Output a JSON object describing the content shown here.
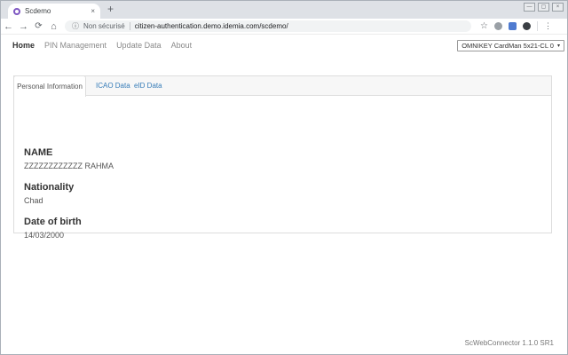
{
  "window": {
    "tab_title": "Scdemo",
    "icons": {
      "tab_close": "×",
      "new_tab": "+",
      "minimize": "—",
      "restore": "▢",
      "close": "×"
    }
  },
  "toolbar": {
    "icons": {
      "back": "←",
      "forward": "→",
      "reload": "⟳",
      "home": "⌂",
      "bookmark_star": "☆",
      "info": "ⓘ",
      "menu_dots": "⋮"
    },
    "security_label": "Non sécurisé",
    "url": "citizen-authentication.demo.idemia.com/scdemo/"
  },
  "sitenav": {
    "items": [
      {
        "label": "Home",
        "active": true
      },
      {
        "label": "PIN Management",
        "active": false
      },
      {
        "label": "Update Data",
        "active": false
      },
      {
        "label": "About",
        "active": false
      }
    ],
    "reader_selected": "OMNIKEY CardMan 5x21-CL 0",
    "reader_caret": "▾"
  },
  "tabs": [
    {
      "label": "Personal Information",
      "active": true
    },
    {
      "label": "ICAO Data",
      "active": false
    },
    {
      "label": "eID Data",
      "active": false
    }
  ],
  "fields": [
    {
      "label": "NAME",
      "value": "ZZZZZZZZZZZZ RAHMA"
    },
    {
      "label": "Nationality",
      "value": "Chad"
    },
    {
      "label": "Date of birth",
      "value": "14/03/2000"
    }
  ],
  "footer": {
    "version": "ScWebConnector 1.1.0 SR1"
  },
  "colors": {
    "tabstrip_bg": "#dee1e6",
    "omnibox_bg": "#f1f3f4",
    "link_blue": "#337ab7",
    "favicon_purple": "#7e57c2",
    "card_border": "#dddddd"
  }
}
